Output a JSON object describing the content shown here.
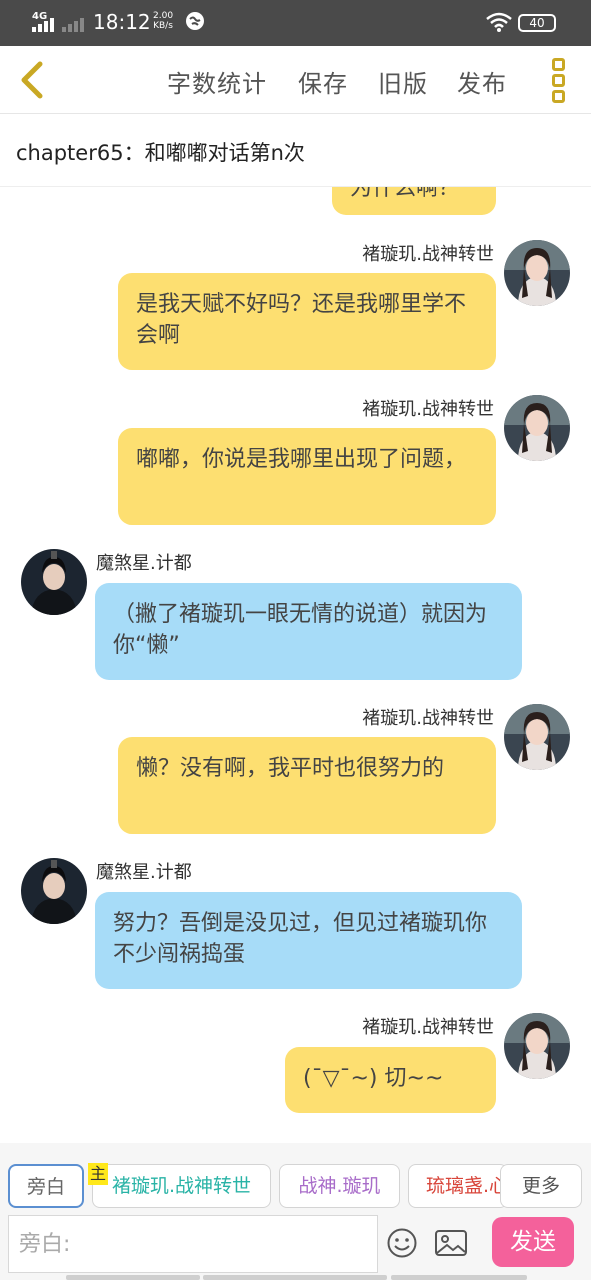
{
  "status_bar": {
    "network": "4G",
    "time": "18:12",
    "speed_value": "2.00",
    "speed_unit": "KB/s",
    "battery": "40"
  },
  "toolbar": {
    "word_count": "字数统计",
    "save": "保存",
    "old_version": "旧版",
    "publish": "发布"
  },
  "chapter": {
    "title": "chapter65：和嘟嘟对话第n次"
  },
  "messages": [
    {
      "side": "right",
      "speaker": "",
      "text": "为什么啊？",
      "color": "#fddf71"
    },
    {
      "side": "right",
      "speaker": "褚璇玑.战神转世",
      "text": "是我天赋不好吗？还是我哪里学不会啊",
      "color": "#fddf71"
    },
    {
      "side": "right",
      "speaker": "褚璇玑.战神转世",
      "text": "嘟嘟，你说是我哪里出现了问题，",
      "color": "#fddf71"
    },
    {
      "side": "left",
      "speaker": "魔煞星.计都",
      "text": "（撇了褚璇玑一眼无情的说道）就因为你“懒”",
      "color": "#a7dcf8"
    },
    {
      "side": "right",
      "speaker": "褚璇玑.战神转世",
      "text": "懒？没有啊，我平时也很努力的",
      "color": "#fddf71"
    },
    {
      "side": "left",
      "speaker": "魔煞星.计都",
      "text": "努力？吾倒是没见过，但见过褚璇玑你不少闯祸捣蛋",
      "color": "#a7dcf8"
    },
    {
      "side": "right",
      "speaker": "褚璇玑.战神转世",
      "text": "(¯▽¯~) 切~~",
      "color": "#fddf71"
    }
  ],
  "roles": {
    "narration": "旁白",
    "main_badge": "主",
    "role1": {
      "label": "褚璇玑.战神转世",
      "color": "#29b3a6"
    },
    "role2": {
      "label": "战神.璇玑",
      "color": "#a86cc9"
    },
    "role3": {
      "label": "琉璃盏.心",
      "color": "#d8453a"
    },
    "more": "更多"
  },
  "input": {
    "placeholder": "旁白:",
    "send": "发送"
  },
  "colors": {
    "accent_gold": "#c9a824",
    "send_pink": "#f4619b",
    "bubble_yellow": "#fddf71",
    "bubble_blue": "#a7dcf8"
  }
}
